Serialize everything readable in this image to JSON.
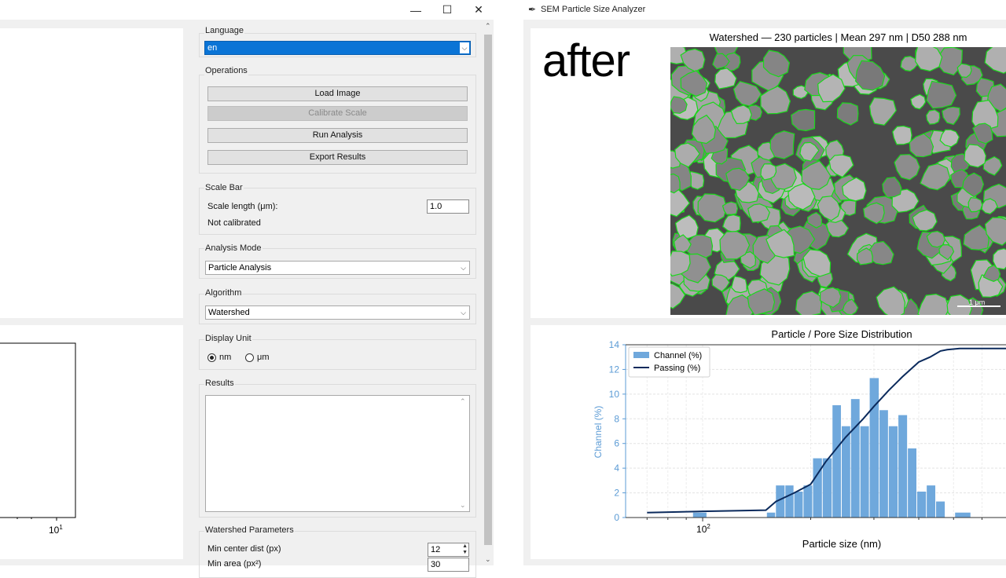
{
  "left_window": {
    "controls": {
      "minimize": "—",
      "maximize": "☐",
      "close": "✕"
    },
    "plot_tick": "10",
    "plot_tick_exp": "1"
  },
  "panel": {
    "language": {
      "title": "Language",
      "value": "en"
    },
    "operations": {
      "title": "Operations",
      "buttons": [
        "Load Image",
        "Calibrate Scale",
        "Run Analysis",
        "Export Results"
      ]
    },
    "scale_bar": {
      "title": "Scale Bar",
      "length_label": "Scale length (μm):",
      "length_value": "1.0",
      "status": "Not calibrated"
    },
    "analysis_mode": {
      "title": "Analysis Mode",
      "value": "Particle Analysis"
    },
    "algorithm": {
      "title": "Algorithm",
      "value": "Watershed"
    },
    "display_unit": {
      "title": "Display Unit",
      "options": [
        "nm",
        "μm"
      ],
      "selected": "nm"
    },
    "results": {
      "title": "Results",
      "text": ""
    },
    "watershed": {
      "title": "Watershed Parameters",
      "min_center_label": "Min center dist (px)",
      "min_center_value": "12",
      "min_area_label": "Min area (px²)",
      "min_area_value": "30"
    }
  },
  "right_window": {
    "title": "SEM Particle Size Analyzer",
    "after_label": "after",
    "image_title": "Watershed — 230 particles | Mean 297 nm | D50 288 nm",
    "scalebar_label": "1 μm"
  },
  "chart_data": {
    "type": "bar",
    "title": "Particle / Pore Size Distribution",
    "xlabel": "Particle size (nm)",
    "ylabel": "Channel (%)",
    "xscale": "log",
    "xlim": [
      61,
      700
    ],
    "ylim": [
      0,
      14
    ],
    "yticks": [
      0,
      2,
      4,
      6,
      8,
      10,
      12,
      14
    ],
    "xtick_labels": [
      {
        "value": 100,
        "base": "10",
        "exp": "2"
      }
    ],
    "legend": {
      "placement": "top-left",
      "entries": [
        "Channel (%)",
        "Passing (%)"
      ]
    },
    "grid": true,
    "colors": {
      "bars": "#6fa8dc",
      "line": "#0b2a5c",
      "axis_left": "#5b9bd5"
    },
    "bin_edges": [
      94,
      103,
      151,
      160,
      170,
      180,
      191,
      203,
      216,
      230,
      244,
      259,
      275,
      292,
      311,
      330,
      351,
      373,
      396,
      421,
      447,
      475,
      505,
      560,
      595
    ],
    "bar_series": {
      "name": "Channel (%)",
      "values": [
        0.4,
        0.0,
        0.4,
        2.6,
        2.6,
        2.1,
        2.6,
        4.8,
        4.8,
        9.1,
        7.4,
        9.6,
        7.4,
        11.3,
        8.7,
        7.4,
        8.3,
        5.6,
        2.1,
        2.6,
        1.3,
        0.0,
        0.4,
        0.0
      ]
    },
    "line_series": {
      "name": "Passing (%)",
      "x": [
        70,
        100,
        150,
        160,
        180,
        200,
        220,
        250,
        280,
        300,
        330,
        360,
        400,
        430,
        460,
        480,
        520,
        600,
        700
      ],
      "y": [
        0.4,
        0.5,
        0.6,
        1.3,
        2.0,
        2.7,
        4.5,
        6.5,
        8.0,
        9.0,
        10.3,
        11.4,
        12.6,
        13.0,
        13.5,
        13.6,
        13.7,
        13.7,
        13.7
      ]
    }
  }
}
